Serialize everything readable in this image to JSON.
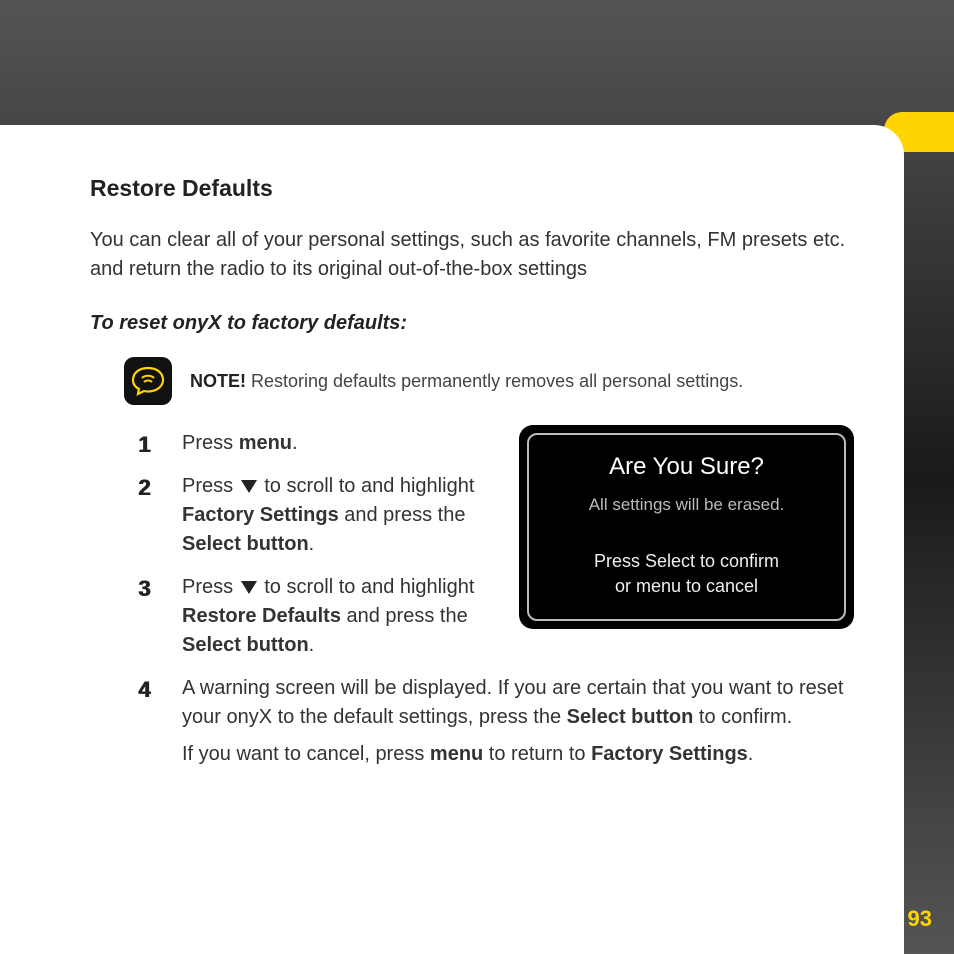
{
  "title": "Restore Defaults",
  "intro": "You can clear all of your personal settings, such as favorite channels, FM presets etc. and return the radio to its original out-of-the-box settings",
  "sub": "To reset onyX to factory defaults:",
  "note_label": "NOTE!",
  "note_text": " Restoring defaults permanently removes all personal settings.",
  "step1_a": "Press ",
  "step1_b": "menu",
  "step1_c": ".",
  "step2_a": "Press ",
  "step2_b": " to scroll to and highlight ",
  "step2_c": "Factory Settings",
  "step2_d": " and press the ",
  "step2_e": "Select button",
  "step2_f": ".",
  "step3_a": "Press ",
  "step3_b": " to scroll to and highlight ",
  "step3_c": "Restore Defaults",
  "step3_d": " and press the ",
  "step3_e": "Select button",
  "step3_f": ".",
  "step4_a": "A warning screen will be displayed. If you are certain that you want to reset your onyX to the default settings, press the ",
  "step4_b": "Select button",
  "step4_c": " to confirm.",
  "step4_d": "If you want to cancel, press ",
  "step4_e": "menu",
  "step4_f": " to return to ",
  "step4_g": "Factory Settings",
  "step4_h": ".",
  "screen_title": "Are You Sure?",
  "screen_sub": "All settings will be erased.",
  "screen_action1": "Press Select to confirm",
  "screen_action2": "or menu to cancel",
  "page_num": "93"
}
